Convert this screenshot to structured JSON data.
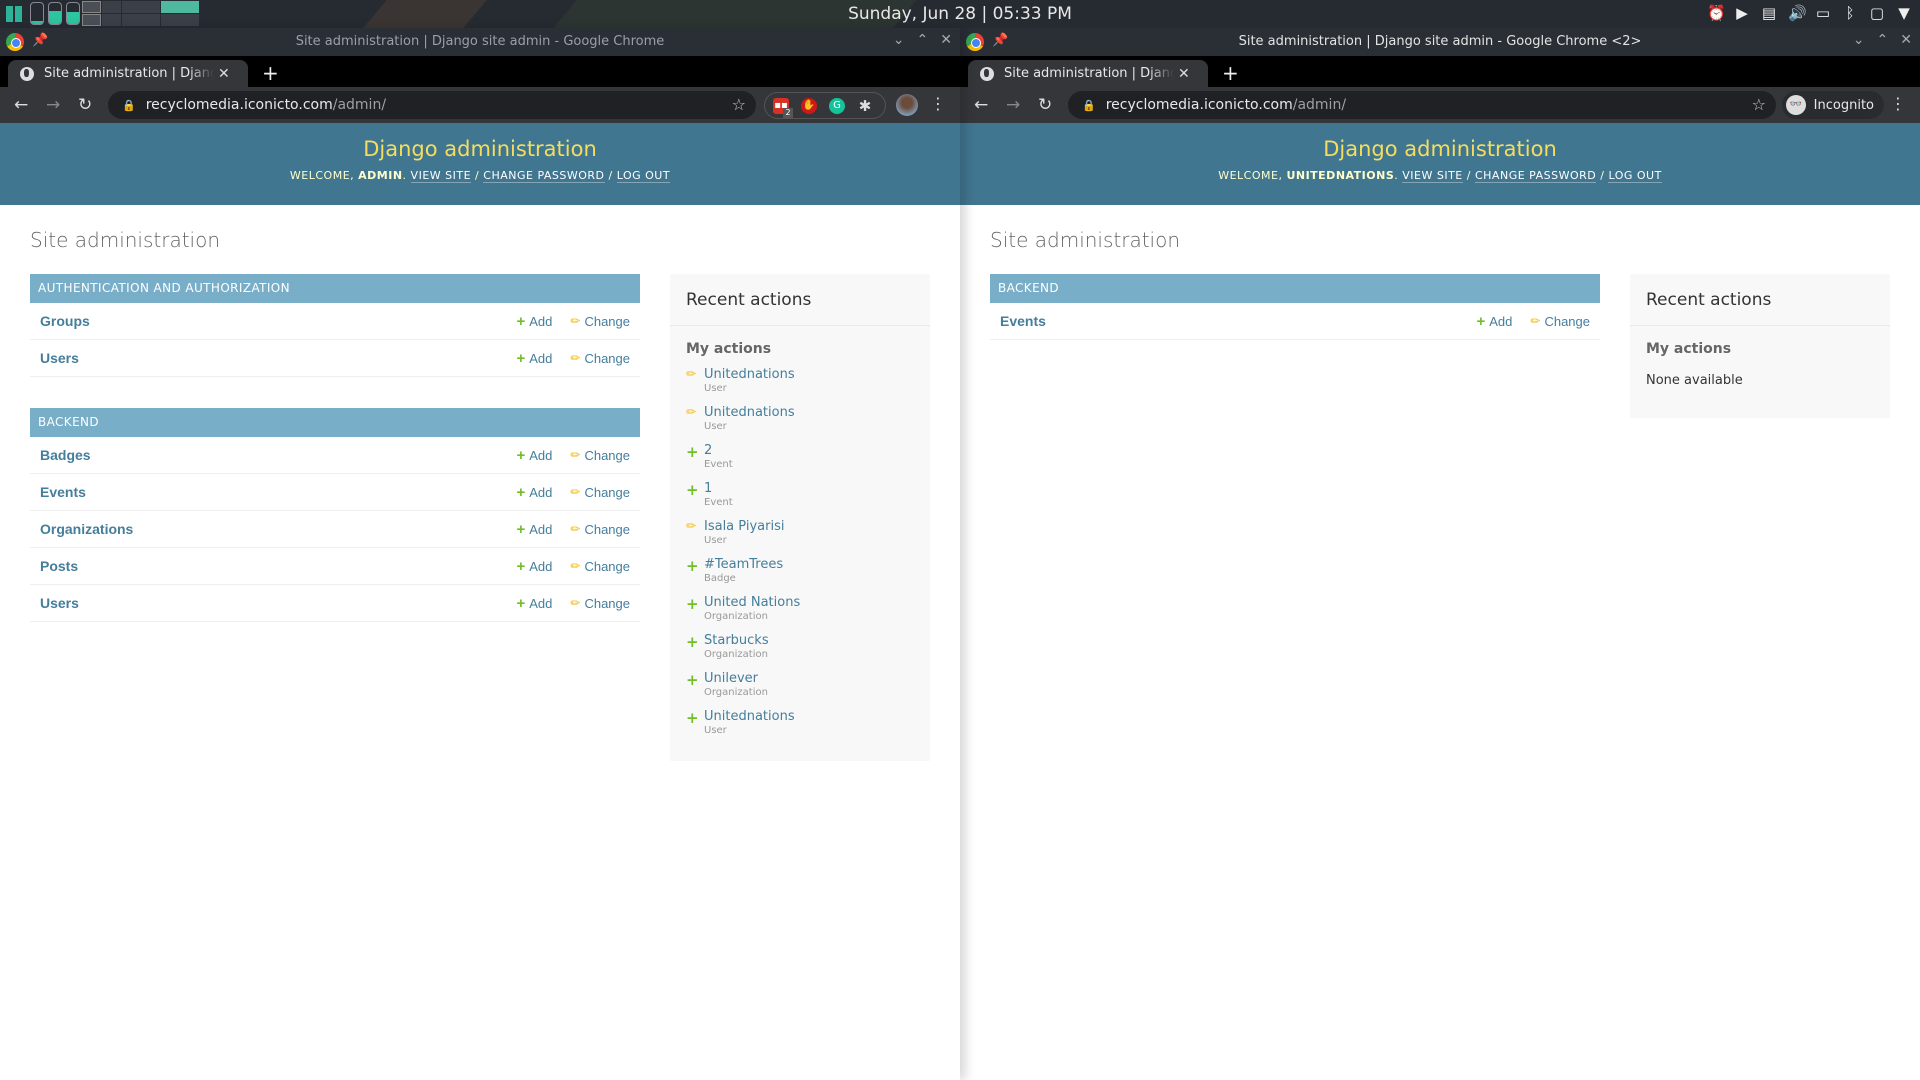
{
  "system": {
    "clock": "Sunday, Jun 28 | 05:33 PM",
    "tray_icons": [
      "alarm-icon",
      "media-play-icon",
      "clipboard-icon",
      "volume-icon",
      "battery-icon",
      "bluetooth-icon",
      "network-icon",
      "dropdown-icon"
    ]
  },
  "left_window": {
    "window_title": "Site administration | Django site admin - Google Chrome",
    "tab_title": "Site administration | Django site admin",
    "url_host": "recyclomedia.iconicto.com",
    "url_path": "/admin/",
    "extension_badge": "2",
    "page": {
      "branding": "Django administration",
      "welcome": "Welcome,",
      "username": "admin",
      "view_site": "View site",
      "change_password": "Change password",
      "log_out": "Log out",
      "sep": "/",
      "heading": "Site administration",
      "modules": [
        {
          "caption": "Authentication and Authorization",
          "models": [
            {
              "name": "Groups",
              "add": "Add",
              "change": "Change"
            },
            {
              "name": "Users",
              "add": "Add",
              "change": "Change"
            }
          ]
        },
        {
          "caption": "Backend",
          "models": [
            {
              "name": "Badges",
              "add": "Add",
              "change": "Change"
            },
            {
              "name": "Events",
              "add": "Add",
              "change": "Change"
            },
            {
              "name": "Organizations",
              "add": "Add",
              "change": "Change"
            },
            {
              "name": "Posts",
              "add": "Add",
              "change": "Change"
            },
            {
              "name": "Users",
              "add": "Add",
              "change": "Change"
            }
          ]
        }
      ],
      "recent_title": "Recent actions",
      "my_actions": "My actions",
      "actions": [
        {
          "type": "change",
          "title": "Unitednations",
          "model": "User"
        },
        {
          "type": "change",
          "title": "Unitednations",
          "model": "User"
        },
        {
          "type": "add",
          "title": "2",
          "model": "Event"
        },
        {
          "type": "add",
          "title": "1",
          "model": "Event"
        },
        {
          "type": "change",
          "title": "Isala Piyarisi",
          "model": "User"
        },
        {
          "type": "add",
          "title": "#TeamTrees",
          "model": "Badge"
        },
        {
          "type": "add",
          "title": "United Nations",
          "model": "Organization"
        },
        {
          "type": "add",
          "title": "Starbucks",
          "model": "Organization"
        },
        {
          "type": "add",
          "title": "Unilever",
          "model": "Organization"
        },
        {
          "type": "add",
          "title": "Unitednations",
          "model": "User"
        }
      ]
    }
  },
  "right_window": {
    "window_title": "Site administration | Django site admin - Google Chrome <2>",
    "tab_title": "Site administration | Django site admin",
    "url_host": "recyclomedia.iconicto.com",
    "url_path": "/admin/",
    "incognito_label": "Incognito",
    "page": {
      "branding": "Django administration",
      "welcome": "Welcome,",
      "username": "unitednations",
      "view_site": "View site",
      "change_password": "Change password",
      "log_out": "Log out",
      "sep": "/",
      "heading": "Site administration",
      "modules": [
        {
          "caption": "Backend",
          "models": [
            {
              "name": "Events",
              "add": "Add",
              "change": "Change"
            }
          ]
        }
      ],
      "recent_title": "Recent actions",
      "my_actions": "My actions",
      "none_available": "None available"
    }
  },
  "colors": {
    "header_bg": "#417690",
    "branding": "#f5dd5d",
    "module_caption": "#79aec8",
    "link": "#447e9b",
    "add_icon": "#70bf2b",
    "change_icon": "#efb80b"
  }
}
